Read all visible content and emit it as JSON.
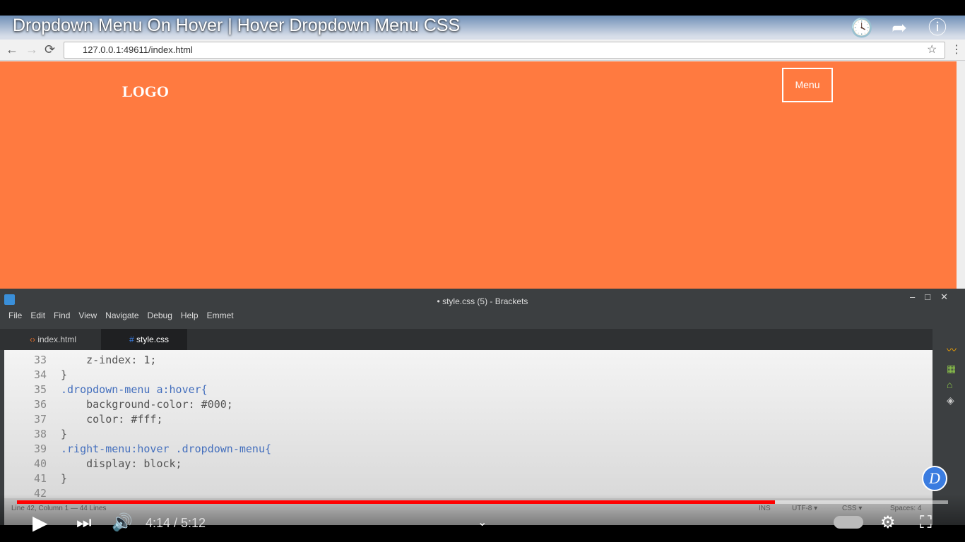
{
  "video": {
    "title": "Dropdown Menu On Hover | Hover Dropdown Menu CSS",
    "time": "4:14 / 5:12",
    "progress": 0.814
  },
  "browser": {
    "url": "127.0.0.1:49611/index.html"
  },
  "page": {
    "logo": "LOGO",
    "menu": "Menu",
    "bg": "#ff7a40"
  },
  "editor": {
    "title": "• style.css (5) - Brackets",
    "menu": [
      "File",
      "Edit",
      "Find",
      "View",
      "Navigate",
      "Debug",
      "Help",
      "Emmet"
    ],
    "tabs": [
      "index.html",
      "style.css"
    ],
    "lines": [
      {
        "n": "33",
        "t": "    z-index: 1;"
      },
      {
        "n": "34",
        "t": "}"
      },
      {
        "n": "35",
        "t": ".dropdown-menu a:hover{"
      },
      {
        "n": "36",
        "t": "    background-color: #000;"
      },
      {
        "n": "37",
        "t": "    color: #fff;"
      },
      {
        "n": "38",
        "t": "}"
      },
      {
        "n": "39",
        "t": ".right-menu:hover .dropdown-menu{"
      },
      {
        "n": "40",
        "t": "    display: block;"
      },
      {
        "n": "41",
        "t": "}"
      },
      {
        "n": "42",
        "t": ""
      }
    ],
    "status": {
      "position": "Line 42, Column 1 — 44 Lines",
      "ins": "INS",
      "encoding": "UTF-8 ▾",
      "lang": "CSS ▾",
      "spaces": "Spaces: 4"
    }
  },
  "badge": "D"
}
